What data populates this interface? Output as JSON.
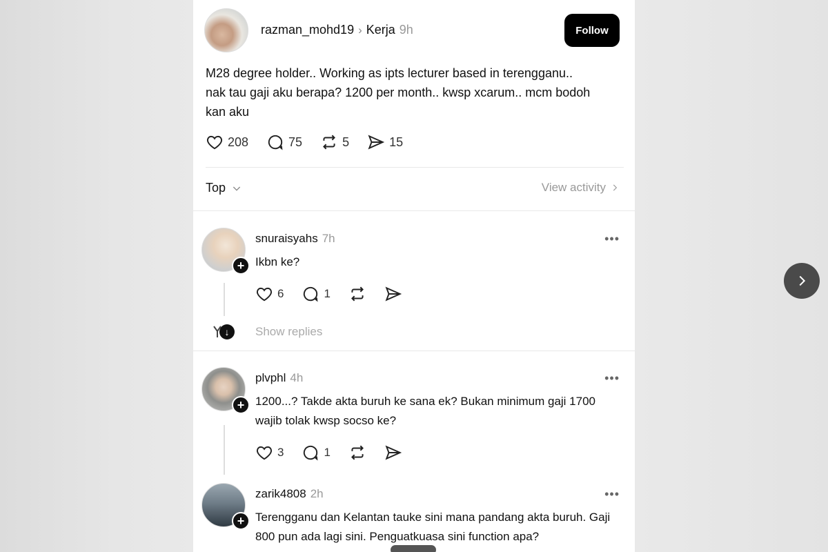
{
  "post": {
    "author": "razman_mohd19",
    "topic": "Kerja",
    "time": "9h",
    "follow_label": "Follow",
    "text": "M28 degree holder.. Working as ipts lecturer based in terengganu..\nnak tau gaji aku berapa? 1200 per month.. kwsp xcarum.. mcm bodoh\nkan aku",
    "likes": "208",
    "comments": "75",
    "reposts": "5",
    "shares": "15"
  },
  "sort": {
    "label": "Top",
    "view_activity": "View activity"
  },
  "comments": [
    {
      "user": "snuraisyahs",
      "time": "7h",
      "text": "Ikbn ke?",
      "likes": "6",
      "replies": "1",
      "show_replies": "Show replies"
    },
    {
      "user": "plvphl",
      "time": "4h",
      "text": "1200...? Takde akta buruh ke sana ek? Bukan minimum gaji 1700 wajib tolak kwsp socso ke?",
      "likes": "3",
      "replies": "1"
    },
    {
      "user": "zarik4808",
      "time": "2h",
      "text": "Terengganu dan Kelantan tauke sini mana pandang akta buruh. Gaji 800 pun ada lagi sini. Penguatkuasa sini function apa?"
    }
  ],
  "more_label": "•••",
  "icons": {
    "like": "heart-icon",
    "comment": "comment-bubble-icon",
    "repost": "repost-icon",
    "share": "send-icon",
    "next": "chevron-right-icon"
  }
}
